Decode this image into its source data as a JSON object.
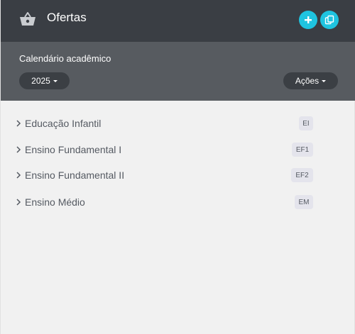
{
  "header": {
    "icon": "shopping-basket-icon",
    "title": "Ofertas",
    "add_icon": "plus-icon",
    "copy_icon": "copy-icon",
    "accent": "#1fc4e0"
  },
  "subbar": {
    "label": "Calendário acadêmico",
    "year": "2025",
    "actions": "Ações"
  },
  "offers": [
    {
      "name": "Educação Infantil",
      "code": "EI"
    },
    {
      "name": "Ensino Fundamental I",
      "code": "EF1"
    },
    {
      "name": "Ensino Fundamental II",
      "code": "EF2"
    },
    {
      "name": "Ensino Médio",
      "code": "EM"
    }
  ]
}
